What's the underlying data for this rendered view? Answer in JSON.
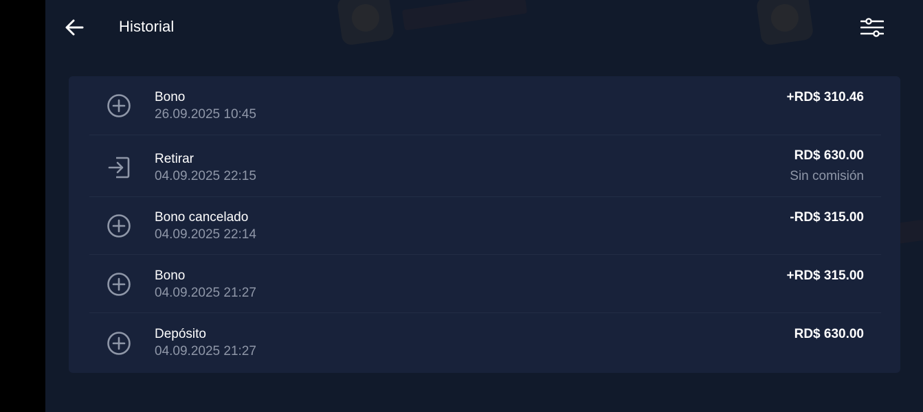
{
  "header": {
    "title": "Historial",
    "back_icon": "arrow-left-icon",
    "filter_icon": "sliders-icon"
  },
  "colors": {
    "background": "#111a2b",
    "card": "#18223a",
    "text_primary": "#ffffff",
    "text_secondary": "#8f97a8"
  },
  "transactions": [
    {
      "title": "Bono",
      "date": "26.09.2025 10:45",
      "amount": "+RD$ 310.46",
      "note": "",
      "icon": "plus-circle-icon"
    },
    {
      "title": "Retirar",
      "date": "04.09.2025 22:15",
      "amount": "RD$ 630.00",
      "note": "Sin comisión",
      "icon": "withdraw-icon"
    },
    {
      "title": "Bono cancelado",
      "date": "04.09.2025 22:14",
      "amount": "-RD$ 315.00",
      "note": "",
      "icon": "plus-circle-icon"
    },
    {
      "title": "Bono",
      "date": "04.09.2025 21:27",
      "amount": "+RD$ 315.00",
      "note": "",
      "icon": "plus-circle-icon"
    },
    {
      "title": "Depósito",
      "date": "04.09.2025 21:27",
      "amount": "RD$ 630.00",
      "note": "",
      "icon": "plus-circle-icon"
    }
  ]
}
